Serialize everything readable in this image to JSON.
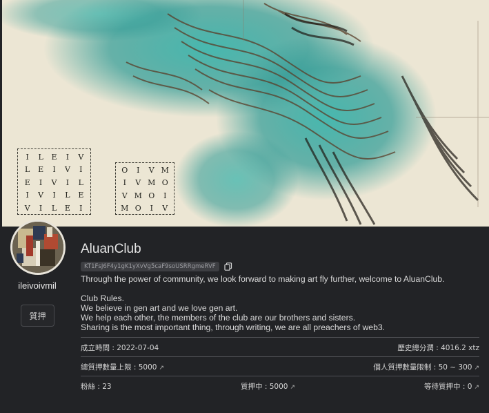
{
  "banner": {
    "grid_left": [
      [
        "I",
        "L",
        "E",
        "I",
        "V"
      ],
      [
        "L",
        "E",
        "I",
        "V",
        "I"
      ],
      [
        "E",
        "I",
        "V",
        "I",
        "L"
      ],
      [
        "I",
        "V",
        "I",
        "L",
        "E"
      ],
      [
        "V",
        "I",
        "L",
        "E",
        "I"
      ]
    ],
    "grid_right": [
      [
        "O",
        "I",
        "V",
        "M"
      ],
      [
        "I",
        "V",
        "M",
        "O"
      ],
      [
        "V",
        "M",
        "O",
        "I"
      ],
      [
        "M",
        "O",
        "I",
        "V"
      ]
    ]
  },
  "profile": {
    "username": "ileivoivmil",
    "stake_button": "質押"
  },
  "club": {
    "name": "AluanClub",
    "address": "KT1FsJ6F4y1gK1yXvVg5caF9soUSRRgmeRVF",
    "description": [
      "Through the power of community, we look forward to making art fly further, welcome to AluanClub.",
      "",
      "Club Rules.",
      "We believe in gen art and we love gen art.",
      "We help each other, the members of the club are our brothers and sisters.",
      "Sharing is the most important thing, through writing, we are all preachers of web3."
    ]
  },
  "stats": {
    "founded": "成立時間 : 2022-07-04",
    "total_dividend": "歷史總分潤 : 4016.2 xtz",
    "total_stake_limit": "總質押數量上限 : 5000",
    "personal_stake_limit": "個人質押數量限制 : 50 ~ 300",
    "followers": "粉絲 : 23",
    "staking": "質押中 : 5000",
    "pending": "等待質押中 : 0",
    "ext_symbol": "↗"
  },
  "colors": {
    "background": "#222326",
    "teal": "#2a9d98",
    "cream": "#ece6d4"
  }
}
